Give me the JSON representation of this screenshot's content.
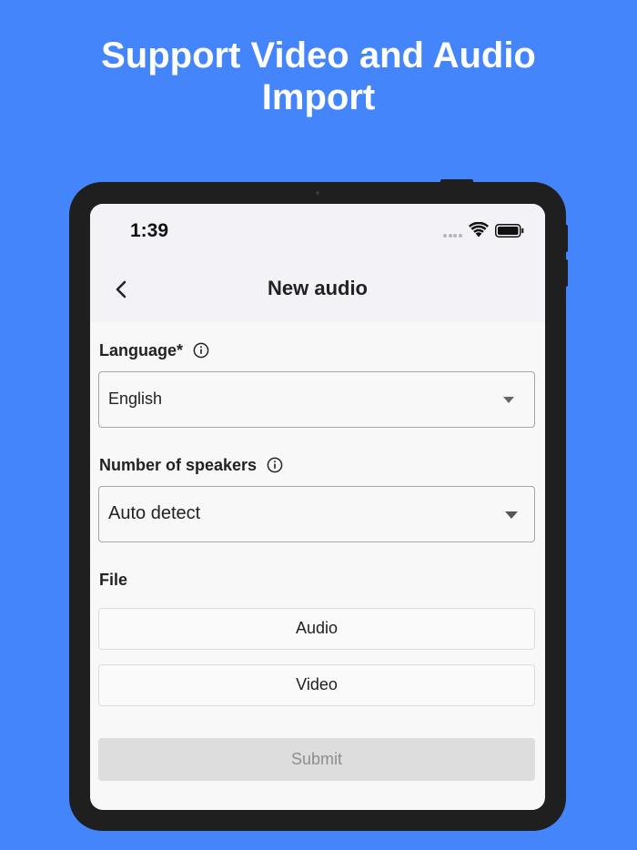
{
  "headline": {
    "line1": "Support Video and Audio",
    "line2": "Import"
  },
  "status_bar": {
    "time": "1:39",
    "icons": [
      "cellular-dots-icon",
      "wifi-icon",
      "battery-icon"
    ]
  },
  "nav": {
    "title": "New audio",
    "back_icon": "chevron-left-icon"
  },
  "form": {
    "language": {
      "label": "Language*",
      "value": "English"
    },
    "speakers": {
      "label": "Number of speakers",
      "value": "Auto detect"
    },
    "file": {
      "label": "File",
      "audio_button": "Audio",
      "video_button": "Video"
    },
    "submit_label": "Submit"
  },
  "colors": {
    "background": "#4485fb",
    "device": "#1f1f1f",
    "screen": "#f8f8f8",
    "nav_bar": "#f3f2f7",
    "submit_disabled": "#dddddd",
    "submit_text_disabled": "#8e8e8e"
  }
}
